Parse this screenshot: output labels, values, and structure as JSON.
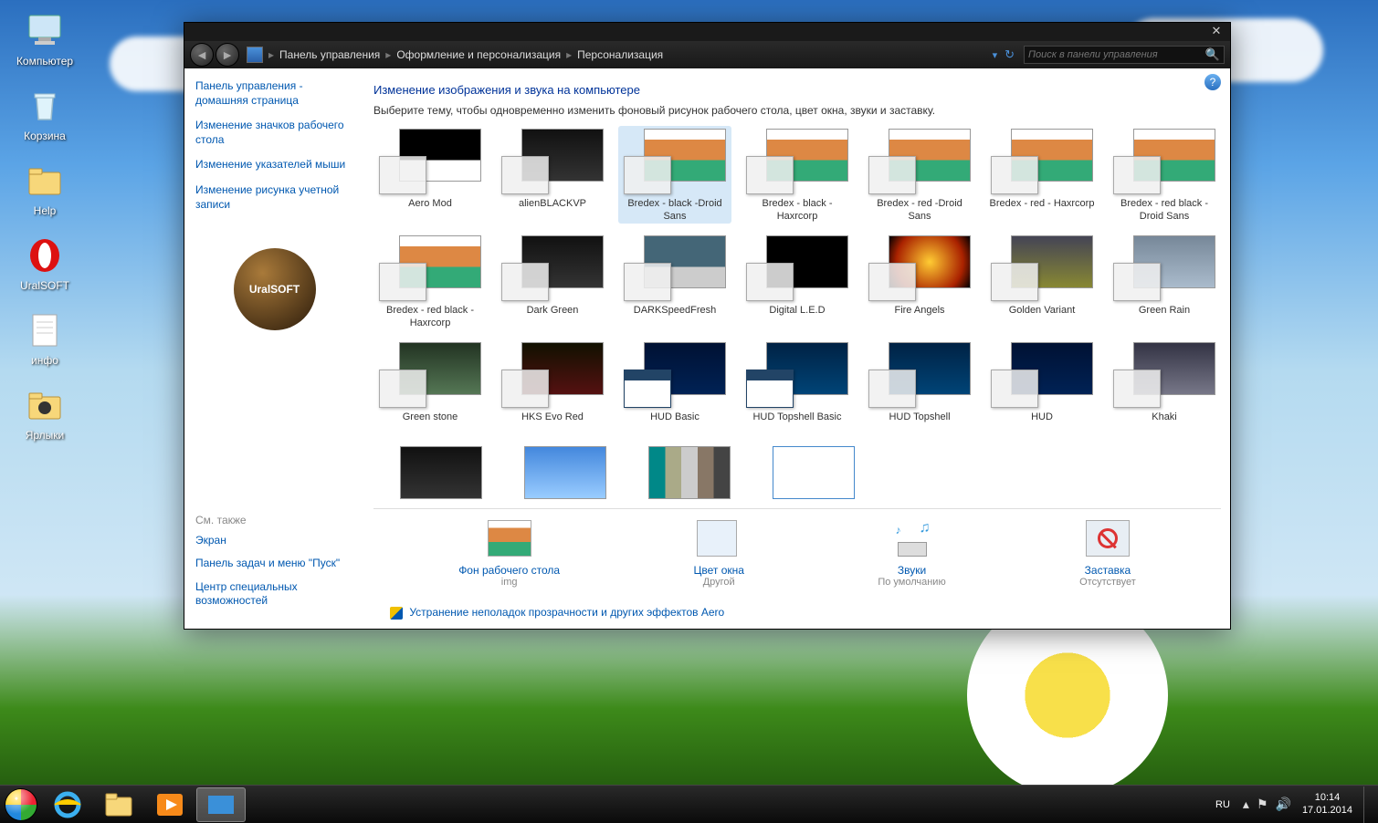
{
  "desktop": {
    "icons": [
      {
        "label": "Компьютер",
        "name": "computer"
      },
      {
        "label": "Корзина",
        "name": "recycle-bin"
      },
      {
        "label": "Help",
        "name": "help-folder"
      },
      {
        "label": "UralSOFT",
        "name": "uralsoft-opera"
      },
      {
        "label": "инфо",
        "name": "info-file"
      },
      {
        "label": "Ярлыки",
        "name": "shortcuts-folder"
      }
    ]
  },
  "window": {
    "breadcrumb": [
      "Панель управления",
      "Оформление и персонализация",
      "Персонализация"
    ],
    "search_placeholder": "Поиск в панели управления",
    "sidebar": {
      "links": [
        "Панель управления - домашняя страница",
        "Изменение значков рабочего стола",
        "Изменение указателей мыши",
        "Изменение рисунка учетной записи"
      ],
      "logo_text": "UralSOFT",
      "seealso_header": "См. также",
      "seealso": [
        "Экран",
        "Панель задач и меню \"Пуск\"",
        "Центр специальных возможностей"
      ]
    },
    "main": {
      "title": "Изменение изображения и звука на компьютере",
      "desc": "Выберите тему, чтобы одновременно изменить фоновый рисунок рабочего стола, цвет окна, звуки и заставку.",
      "themes": [
        [
          {
            "label": "Aero Mod",
            "bg": "bg-bw",
            "sel": false
          },
          {
            "label": "alienBLACKVP",
            "bg": "bg-dark",
            "sel": false
          },
          {
            "label": "Bredex - black -Droid Sans",
            "bg": "bg-flowers",
            "sel": true
          },
          {
            "label": "Bredex - black - Haxrcorp",
            "bg": "bg-flowers",
            "sel": false
          },
          {
            "label": "Bredex - red -Droid Sans",
            "bg": "bg-flowers",
            "sel": false
          },
          {
            "label": "Bredex - red - Haxrcorp",
            "bg": "bg-flowers",
            "sel": false
          },
          {
            "label": "Bredex - red black -Droid Sans",
            "bg": "bg-flowers",
            "sel": false
          }
        ],
        [
          {
            "label": "Bredex - red black - Haxrcorp",
            "bg": "bg-flowers",
            "sel": false
          },
          {
            "label": "Dark Green",
            "bg": "bg-dark",
            "sel": false
          },
          {
            "label": "DARKSpeedFresh",
            "bg": "bg-car",
            "sel": false
          },
          {
            "label": "Digital L.E.D",
            "bg": "bg-neon",
            "sel": false
          },
          {
            "label": "Fire Angels",
            "bg": "bg-fire",
            "sel": false
          },
          {
            "label": "Golden Variant",
            "bg": "bg-gold",
            "sel": false
          },
          {
            "label": "Green Rain",
            "bg": "bg-rain",
            "sel": false
          }
        ],
        [
          {
            "label": "Green stone",
            "bg": "bg-green2",
            "sel": false
          },
          {
            "label": "HKS Evo Red",
            "bg": "bg-red",
            "sel": false
          },
          {
            "label": "HUD Basic",
            "bg": "bg-blue",
            "wp": "wp-winb",
            "sel": false
          },
          {
            "label": "HUD Topshell Basic",
            "bg": "bg-blue2",
            "wp": "wp-winb",
            "sel": false
          },
          {
            "label": "HUD Topshell",
            "bg": "bg-blue2",
            "sel": false
          },
          {
            "label": "HUD",
            "bg": "bg-blue",
            "sel": false
          },
          {
            "label": "Khaki",
            "bg": "bg-khaki",
            "sel": false
          }
        ],
        [
          {
            "label": "",
            "bg": "bg-dark",
            "partial": true
          },
          {
            "label": "",
            "bg": "bg-water",
            "partial": true
          },
          {
            "label": "",
            "bg": "bg-palette",
            "partial": true
          },
          {
            "label": "",
            "bg": "bg-scr",
            "partial": true
          }
        ]
      ],
      "bottom": [
        {
          "title": "Фон рабочего стола",
          "sub": "img",
          "name": "desktop-background"
        },
        {
          "title": "Цвет окна",
          "sub": "Другой",
          "name": "window-color"
        },
        {
          "title": "Звуки",
          "sub": "По умолчанию",
          "name": "sounds"
        },
        {
          "title": "Заставка",
          "sub": "Отсутствует",
          "name": "screensaver"
        }
      ],
      "troubleshoot": "Устранение неполадок прозрачности и других эффектов Aero"
    }
  },
  "taskbar": {
    "lang": "RU",
    "time": "10:14",
    "date": "17.01.2014"
  }
}
